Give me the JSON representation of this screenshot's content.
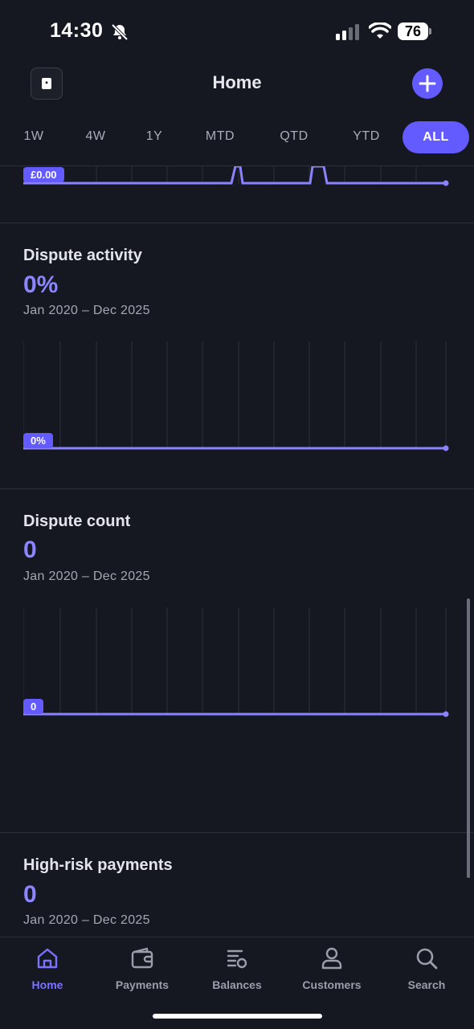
{
  "status_bar": {
    "time": "14:30",
    "battery": "76"
  },
  "header": {
    "title": "Home"
  },
  "range_tabs": [
    {
      "label": "1W"
    },
    {
      "label": "4W"
    },
    {
      "label": "1Y"
    },
    {
      "label": "MTD"
    },
    {
      "label": "QTD"
    },
    {
      "label": "YTD"
    },
    {
      "label": "ALL",
      "active": true
    }
  ],
  "top_chart": {
    "value_tag": "£0.00"
  },
  "sections": [
    {
      "title": "Dispute activity",
      "value": "0%",
      "range": "Jan 2020 – Dec 2025",
      "tag": "0%"
    },
    {
      "title": "Dispute count",
      "value": "0",
      "range": "Jan 2020 – Dec 2025",
      "tag": "0"
    },
    {
      "title": "High-risk payments",
      "value": "0",
      "range": "Jan 2020 – Dec 2025"
    }
  ],
  "chart_data": [
    {
      "type": "line",
      "title": "Dispute activity",
      "x": [
        "Jan 2020",
        "Dec 2025"
      ],
      "series": [
        {
          "values": [
            0,
            0
          ]
        }
      ],
      "grid": true
    },
    {
      "type": "line",
      "title": "Dispute count",
      "x": [
        "Jan 2020",
        "Dec 2025"
      ],
      "series": [
        {
          "values": [
            0,
            0
          ]
        }
      ],
      "grid": true
    }
  ],
  "bottom_nav": [
    {
      "label": "Home",
      "icon": "home-icon",
      "active": true
    },
    {
      "label": "Payments",
      "icon": "wallet-icon"
    },
    {
      "label": "Balances",
      "icon": "balances-icon"
    },
    {
      "label": "Customers",
      "icon": "customer-icon"
    },
    {
      "label": "Search",
      "icon": "search-icon"
    }
  ],
  "colors": {
    "accent": "#635bff",
    "background": "#161821",
    "value_text": "#8b86ff"
  }
}
